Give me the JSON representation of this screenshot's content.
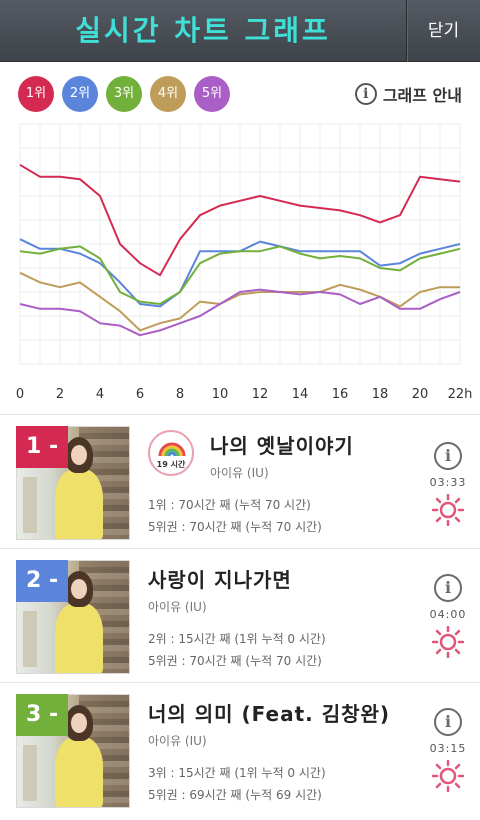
{
  "header": {
    "title": "실시간 차트 그래프",
    "close_label": "닫기"
  },
  "rank_buttons": [
    {
      "label": "1위",
      "color": "#d42a52"
    },
    {
      "label": "2위",
      "color": "#5b85db"
    },
    {
      "label": "3위",
      "color": "#72b03b"
    },
    {
      "label": "4위",
      "color": "#be9c5a"
    },
    {
      "label": "5위",
      "color": "#a95fc5"
    }
  ],
  "guide": {
    "icon": "info-icon",
    "label": "그래프 안내"
  },
  "chart_data": {
    "type": "line",
    "x": [
      0,
      1,
      2,
      3,
      4,
      5,
      6,
      7,
      8,
      9,
      10,
      11,
      12,
      13,
      14,
      15,
      16,
      17,
      18,
      19,
      20,
      21,
      22
    ],
    "x_tick_labels": [
      "0",
      "2",
      "4",
      "6",
      "8",
      "10",
      "12",
      "14",
      "16",
      "18",
      "20",
      "22h"
    ],
    "x_tick_values": [
      0,
      2,
      4,
      6,
      8,
      10,
      12,
      14,
      16,
      18,
      20,
      22
    ],
    "ylim": [
      0,
      100
    ],
    "grid": true,
    "series": [
      {
        "color": "#d42a52",
        "values": [
          83,
          78,
          78,
          77,
          70,
          50,
          42,
          37,
          52,
          62,
          66,
          68,
          70,
          68,
          66,
          65,
          64,
          62,
          59,
          62,
          78,
          77,
          76
        ]
      },
      {
        "color": "#5b85db",
        "values": [
          52,
          48,
          48,
          46,
          42,
          34,
          25,
          24,
          30,
          47,
          47,
          47,
          51,
          49,
          47,
          47,
          47,
          47,
          41,
          42,
          46,
          48,
          50
        ]
      },
      {
        "color": "#72b03b",
        "values": [
          47,
          46,
          48,
          49,
          44,
          30,
          26,
          25,
          30,
          42,
          46,
          47,
          47,
          49,
          46,
          44,
          45,
          44,
          40,
          39,
          44,
          46,
          48
        ]
      },
      {
        "color": "#be9c5a",
        "values": [
          38,
          34,
          32,
          34,
          28,
          22,
          14,
          17,
          19,
          26,
          25,
          29,
          30,
          30,
          30,
          30,
          33,
          31,
          28,
          24,
          30,
          32,
          32
        ]
      },
      {
        "color": "#a95fc5",
        "values": [
          25,
          23,
          23,
          22,
          17,
          16,
          12,
          14,
          17,
          20,
          25,
          30,
          31,
          30,
          29,
          30,
          29,
          25,
          28,
          23,
          23,
          27,
          30
        ]
      }
    ]
  },
  "songs": [
    {
      "rank_label": "1 -",
      "badge_color": "#d42a52",
      "title": "나의 옛날이야기",
      "artist": "아이유 (IU)",
      "has_badge": true,
      "badge_text": "19 시간",
      "stat1": "1위 : 70시간 째 (누적 70 시간)",
      "stat2": "5위권 : 70시간 째 (누적 70 시간)",
      "duration": "03:33"
    },
    {
      "rank_label": "2 -",
      "badge_color": "#5b85db",
      "title": "사랑이 지나가면",
      "artist": "아이유 (IU)",
      "has_badge": false,
      "badge_text": "",
      "stat1": "2위 : 15시간 째 (1위 누적 0 시간)",
      "stat2": "5위권 : 70시간 째 (누적 70 시간)",
      "duration": "04:00"
    },
    {
      "rank_label": "3 -",
      "badge_color": "#72b03b",
      "title": "너의 의미 (Feat. 김창완)",
      "artist": "아이유 (IU)",
      "has_badge": false,
      "badge_text": "",
      "stat1": "3위 : 15시간 째 (1위 누적 0 시간)",
      "stat2": "5위권 : 69시간 째 (누적 69 시간)",
      "duration": "03:15"
    }
  ]
}
